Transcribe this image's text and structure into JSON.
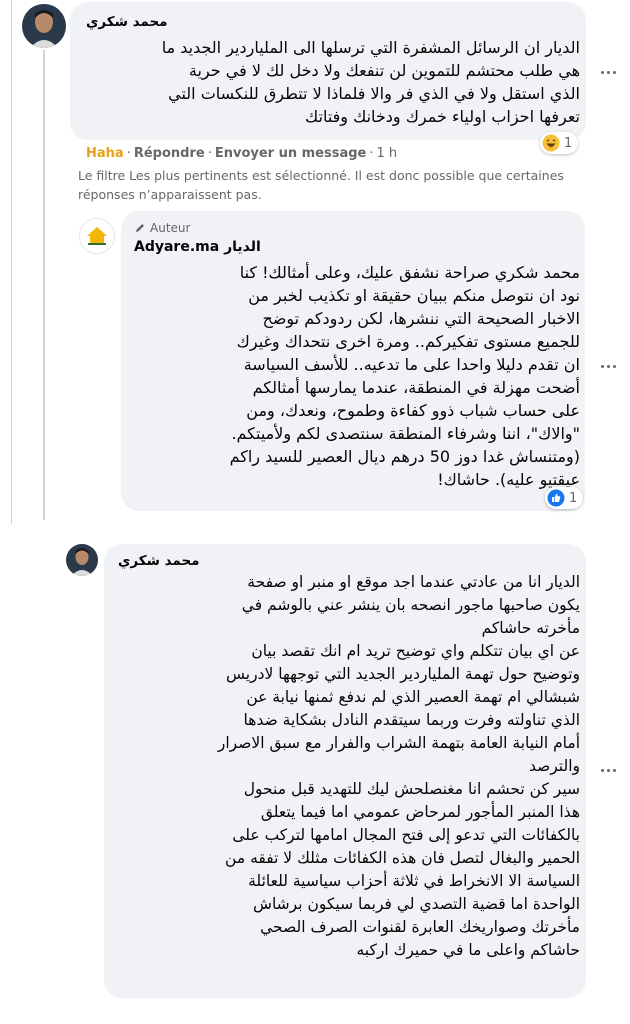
{
  "comment1": {
    "author": "محمد شكري",
    "lines": [
      "الديار ان الرسائل المشفرة التي ترسلها الى الملياردير الجديد ما",
      "هي طلب محتشم للتموين لن تنفعك ولا دخل لك لا في حرية",
      "الذي استقل ولا في الذي فر والا فلماذا لا تتطرق للنكسات التي",
      "تعرفها احزاب اولياء خمرك ودخانك وفتاتك"
    ],
    "reaction_count": "1",
    "actions": {
      "haha": "Haha",
      "reply": "Répondre",
      "message": "Envoyer un message",
      "time": "1 h"
    }
  },
  "filter_note": {
    "line1": "Le filtre Les plus pertinents est sélectionné. Il est donc possible que certaines",
    "line2": "réponses n’apparaissent pas."
  },
  "reply": {
    "badge": "Auteur",
    "author": "Adyare.ma الديار",
    "lines": [
      "محمد شكري صراحة نشفق عليك، وعلى أمثالك! كنا",
      "نود ان نتوصل منكم ببيان حقيقة او تكذيب لخبر من",
      "الاخبار الصحيحة التي ننشرها، لكن ردودكم توضح",
      "للجميع مستوى تفكيركم.. ومرة اخرى نتحداك وغيرك",
      "ان تقدم دليلا واحدا على ما تدعيه.. للأسف السياسة",
      "أضحت مهزلة في المنطقة، عندما يمارسها أمثالكم",
      "على حساب شباب ذوو كفاءة وطموح، ونعدك، ومن",
      "\"والاك\"، اننا وشرفاء المنطقة سنتصدى لكم ولأميتكم.",
      "(ومتنساش غدا دوز 50 درهم ديال العصير للسيد راكم",
      "عيقتيو عليه). حاشاك!"
    ],
    "reaction_count": "1"
  },
  "comment2": {
    "author": "محمد شكري",
    "lines": [
      "الديار انا من عادتي عندما اجد موقع او منبر او صفحة",
      "يكون صاحبها ماجور انصحه بان ينشر عني بالوشم في",
      "مأخرته حاشاكم",
      "عن اي بيان تتكلم واي توضيح تريد ام انك تقصد بيان",
      "وتوضيح حول تهمة الملياردير الجديد التي توجهها لادريس",
      "شبشالي ام تهمة العصير الذي لم ندفع ثمنها نيابة عن",
      "الذي تناولته وفرت وربما سيتقدم النادل بشكاية ضدها",
      "أمام النيابة العامة بتهمة الشراب والفرار مع سبق الاصرار",
      "والترصد",
      "سير كن تحشم انا مغنصلحش ليك للتهديد قبل منحول",
      "هذا المنبر المأجور لمرحاض عمومي اما فيما يتعلق",
      "بالكفائات التي تدعو إلى فتح المجال امامها لتركب على",
      "الحمير والبغال لتصل فان هذه الكفائات مثلك لا تفقه من",
      "السياسة الا الانخراط في ثلاثة أحزاب سياسية للعائلة",
      "الواحدة اما قضية التصدي لي فربما سيكون برشاش",
      "مأخرتك وصواريخك العابرة لقنوات الصرف الصحي",
      "حاشاكم واعلى ما في حميرك اركبه"
    ]
  },
  "colors": {
    "bubble": "#f0f2f5",
    "meta": "#65676b",
    "haha": "#e8a115",
    "like_blue": "#1877f2"
  }
}
